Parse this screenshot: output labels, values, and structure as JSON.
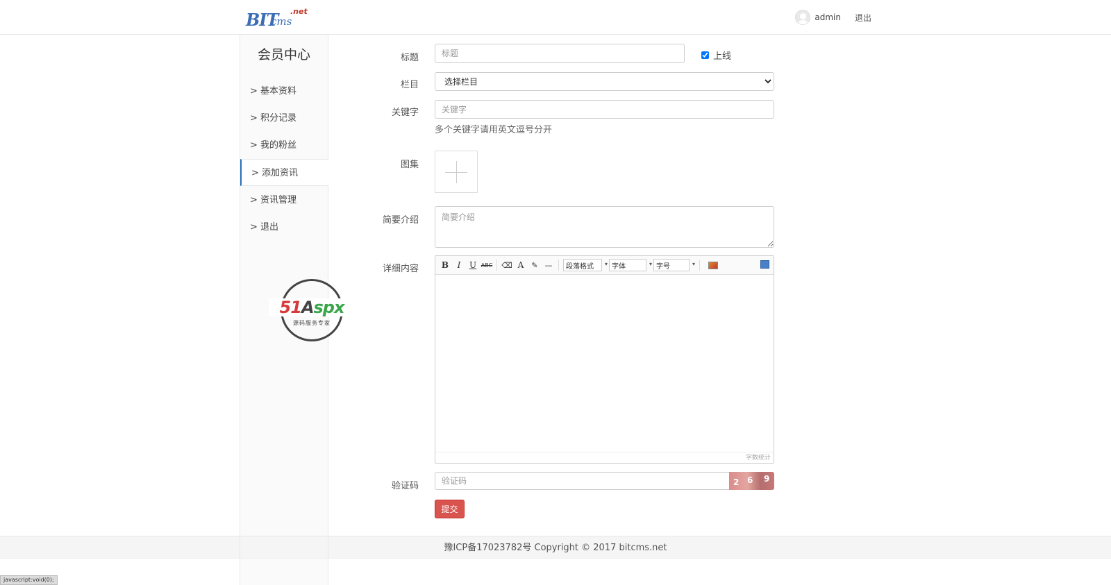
{
  "header": {
    "logo_main": "BIT",
    "logo_sub": "cms",
    "logo_net": ".net",
    "username": "admin",
    "logout": "退出"
  },
  "sidebar": {
    "title": "会员中心",
    "items": [
      {
        "label": "> 基本资料"
      },
      {
        "label": "> 积分记录"
      },
      {
        "label": "> 我的粉丝"
      },
      {
        "label": "> 添加资讯"
      },
      {
        "label": "> 资讯管理"
      },
      {
        "label": "> 退出"
      }
    ],
    "active_index": 3
  },
  "watermark": {
    "main_51": "51",
    "main_a": "A",
    "main_spx": "spx",
    "sub": "源码服务专家"
  },
  "form": {
    "title_label": "标题",
    "title_placeholder": "标题",
    "online_label": "上线",
    "online_checked": true,
    "column_label": "栏目",
    "column_selected": "选择栏目",
    "keywords_label": "关键字",
    "keywords_placeholder": "关键字",
    "keywords_hint": "多个关键字请用英文逗号分开",
    "gallery_label": "图集",
    "summary_label": "简要介绍",
    "summary_placeholder": "简要介绍",
    "content_label": "详细内容",
    "editor": {
      "bold": "B",
      "italic": "I",
      "underline": "U",
      "strike": "ABC",
      "font_color": "A",
      "hr": "—",
      "paragraph_select": "段落格式",
      "font_select": "字体",
      "size_select": "字号",
      "word_count": "字数统计"
    },
    "captcha_label": "验证码",
    "captcha_placeholder": "验证码",
    "captcha_chars": [
      "2",
      "6",
      "9"
    ],
    "submit": "提交"
  },
  "footer": {
    "text": "豫ICP备17023782号 Copyright © 2017 bitcms.net"
  },
  "statusbar": {
    "text": "javascript:void(0);"
  },
  "colors": {
    "accent": "#2a6ebb",
    "submit": "#d9534f",
    "logo": "#3a6db5"
  }
}
